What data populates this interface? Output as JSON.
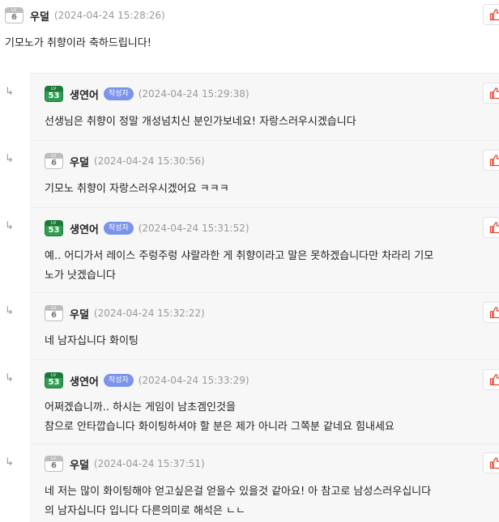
{
  "comments": [
    {
      "level": "6",
      "nickname": "우덜",
      "author_tag": "",
      "timestamp": "(2024-04-24 15:28:26)",
      "lines": [
        "기모노가 취향이라 축하드립니다!"
      ]
    }
  ],
  "replies": [
    {
      "level": "53",
      "nickname": "생연어",
      "author_tag": "작성자",
      "timestamp": "(2024-04-24 15:29:38)",
      "lines": [
        "선생님은 취향이 정말 개성넘치신 분인가보네요! 자랑스러우시겠습니다"
      ]
    },
    {
      "level": "6",
      "nickname": "우덜",
      "author_tag": "",
      "timestamp": "(2024-04-24 15:30:56)",
      "lines": [
        "기모노 취향이 자랑스러우시겠어요 ㅋㅋㅋ"
      ]
    },
    {
      "level": "53",
      "nickname": "생연어",
      "author_tag": "작성자",
      "timestamp": "(2024-04-24 15:31:52)",
      "lines": [
        "예.. 어디가서 레이스 주렁주렁 샤랄라한 게 취향이라고 말은 못하겠습니다만 차라리 기모",
        "노가 낫겠습니다"
      ]
    },
    {
      "level": "6",
      "nickname": "우덜",
      "author_tag": "",
      "timestamp": "(2024-04-24 15:32:22)",
      "lines": [
        "네 남자십니다 화이팅"
      ]
    },
    {
      "level": "53",
      "nickname": "생연어",
      "author_tag": "작성자",
      "timestamp": "(2024-04-24 15:33:29)",
      "lines": [
        "어쩌겠습니까.. 하시는 게임이 남초겜인것을",
        "참으로 안타깝습니다 화이팅하셔야 할 분은 제가 아니라 그쪽분 같네요 힘내세요"
      ]
    },
    {
      "level": "6",
      "nickname": "우덜",
      "author_tag": "",
      "timestamp": "(2024-04-24 15:37:51)",
      "lines": [
        "네 저는 많이 화이팅해야 얻고싶은걸 얻을수 있을것 같아요! 아 참고로 남성스러우십니다",
        "의 남자십니다 입니다 다른의미로 해석은 ㄴㄴ"
      ]
    }
  ],
  "icons": {
    "reply_arrow": "reply-arrow-icon",
    "like": "thumbs-up-icon",
    "level_badge_prefix": "LV"
  },
  "colors": {
    "author_tag_bg": "#7b93ea",
    "like_icon": "#e8472e",
    "reply_bg": "#f7f7f7",
    "level_green": "#2f9e52",
    "level_gray": "#bdbdbd"
  }
}
